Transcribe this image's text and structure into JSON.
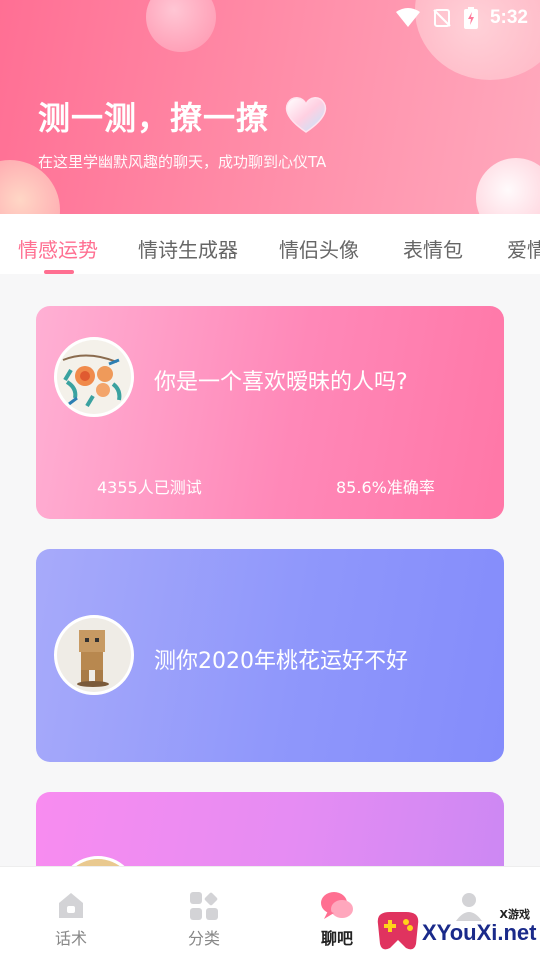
{
  "status_bar": {
    "time": "5:32"
  },
  "header": {
    "title": "测一测，撩一撩",
    "subtitle": "在这里学幽默风趣的聊天，成功聊到心仪TA"
  },
  "tabs": [
    {
      "label": "情感运势",
      "active": true
    },
    {
      "label": "情诗生成器"
    },
    {
      "label": "情侣头像"
    },
    {
      "label": "表情包"
    },
    {
      "label": "爱情"
    }
  ],
  "cards": [
    {
      "title": "你是一个喜欢暧昧的人吗?",
      "tested": "4355人已测试",
      "accuracy": "85.6%准确率"
    },
    {
      "title": "测你2020年桃花运好不好"
    },
    {
      "title": ""
    }
  ],
  "bottom_nav": [
    {
      "label": "话术",
      "icon": "home-icon"
    },
    {
      "label": "分类",
      "icon": "grid-icon"
    },
    {
      "label": "聊吧",
      "icon": "chat-icon",
      "active": true
    },
    {
      "label": "",
      "icon": "profile-icon"
    }
  ],
  "watermark": {
    "small": "X游戏",
    "big": "XYouXi.net"
  },
  "colors": {
    "accent": "#ff6f91",
    "header_start": "#ff6f94",
    "card1": "#ff88b8",
    "card2": "#8f97fb",
    "card3": "#e58cf3"
  }
}
